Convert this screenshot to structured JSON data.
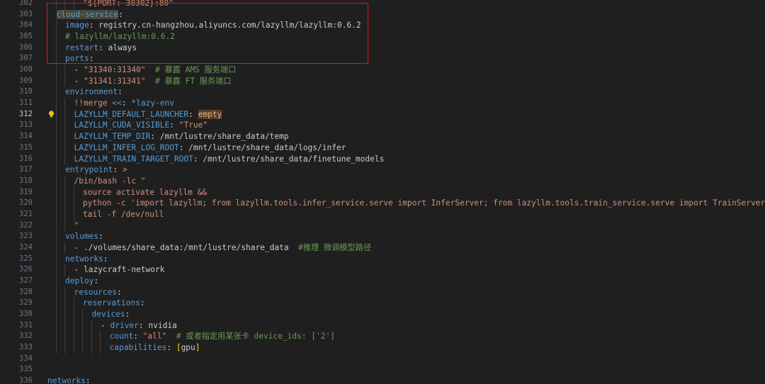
{
  "editor": {
    "active_line": "312",
    "lines": [
      {
        "num": "302",
        "indent": 4,
        "tokens": [
          {
            "t": "\"${PORT: 30302}:80\"",
            "c": "s"
          }
        ]
      },
      {
        "num": "303",
        "indent": 1,
        "tokens": [
          {
            "t": "cloud-service",
            "c": "k selk"
          },
          {
            "t": ":",
            "c": "p"
          }
        ]
      },
      {
        "num": "304",
        "indent": 2,
        "tokens": [
          {
            "t": "image",
            "c": "k"
          },
          {
            "t": ": ",
            "c": "p"
          },
          {
            "t": "registry.cn-hangzhou.aliyuncs.com/lazyllm/lazyllm:0.6.2",
            "c": "r"
          }
        ]
      },
      {
        "num": "305",
        "indent": 2,
        "tokens": [
          {
            "t": "# lazyllm/lazyllm:0.6.2",
            "c": "c"
          }
        ]
      },
      {
        "num": "306",
        "indent": 2,
        "tokens": [
          {
            "t": "restart",
            "c": "k"
          },
          {
            "t": ": ",
            "c": "p"
          },
          {
            "t": "always",
            "c": "r"
          }
        ]
      },
      {
        "num": "307",
        "indent": 2,
        "tokens": [
          {
            "t": "ports",
            "c": "k"
          },
          {
            "t": ":",
            "c": "p"
          }
        ]
      },
      {
        "num": "308",
        "indent": 3,
        "tokens": [
          {
            "t": "- ",
            "c": "p"
          },
          {
            "t": "\"31340:31340\"",
            "c": "s"
          },
          {
            "t": "  # 暴露 AMS 服务端口",
            "c": "c"
          }
        ]
      },
      {
        "num": "309",
        "indent": 3,
        "tokens": [
          {
            "t": "- ",
            "c": "p"
          },
          {
            "t": "\"31341:31341\"",
            "c": "s"
          },
          {
            "t": "  # 暴露 FT 服务端口",
            "c": "c"
          }
        ]
      },
      {
        "num": "310",
        "indent": 2,
        "tokens": [
          {
            "t": "environment",
            "c": "k"
          },
          {
            "t": ":",
            "c": "p"
          }
        ]
      },
      {
        "num": "311",
        "indent": 3,
        "tokens": [
          {
            "t": "!!merge",
            "c": "s"
          },
          {
            "t": " ",
            "c": "p"
          },
          {
            "t": "<<",
            "c": "k"
          },
          {
            "t": ": ",
            "c": "p"
          },
          {
            "t": "*lazy-env",
            "c": "anchor"
          }
        ]
      },
      {
        "num": "312",
        "indent": 3,
        "tokens": [
          {
            "t": "LAZYLLM_DEFAULT_LAUNCHER",
            "c": "k"
          },
          {
            "t": ": ",
            "c": "p"
          },
          {
            "t": "empty",
            "c": "hl"
          }
        ]
      },
      {
        "num": "313",
        "indent": 3,
        "tokens": [
          {
            "t": "LAZYLLM_CUDA_VISIBLE",
            "c": "k"
          },
          {
            "t": ": ",
            "c": "p"
          },
          {
            "t": "\"True\"",
            "c": "s"
          }
        ]
      },
      {
        "num": "314",
        "indent": 3,
        "tokens": [
          {
            "t": "LAZYLLM_TEMP_DIR",
            "c": "k"
          },
          {
            "t": ": ",
            "c": "p"
          },
          {
            "t": "/mnt/lustre/share_data/temp",
            "c": "r"
          }
        ]
      },
      {
        "num": "315",
        "indent": 3,
        "tokens": [
          {
            "t": "LAZYLLM_INFER_LOG_ROOT",
            "c": "k"
          },
          {
            "t": ": ",
            "c": "p"
          },
          {
            "t": "/mnt/lustre/share_data/logs/infer",
            "c": "r"
          }
        ]
      },
      {
        "num": "316",
        "indent": 3,
        "tokens": [
          {
            "t": "LAZYLLM_TRAIN_TARGET_ROOT",
            "c": "k"
          },
          {
            "t": ": ",
            "c": "p"
          },
          {
            "t": "/mnt/lustre/share_data/finetune_models",
            "c": "r"
          }
        ]
      },
      {
        "num": "317",
        "indent": 2,
        "tokens": [
          {
            "t": "entrypoint",
            "c": "k"
          },
          {
            "t": ": ",
            "c": "p"
          },
          {
            "t": ">",
            "c": "s"
          }
        ]
      },
      {
        "num": "318",
        "indent": 3,
        "tokens": [
          {
            "t": "/bin/bash -lc \"",
            "c": "s"
          }
        ]
      },
      {
        "num": "319",
        "indent": 4,
        "tokens": [
          {
            "t": "source activate lazyllm &&",
            "c": "s"
          }
        ]
      },
      {
        "num": "320",
        "indent": 4,
        "tokens": [
          {
            "t": "python -c 'import lazyllm; from lazyllm.tools.infer_service.serve import InferServer; from lazyllm.tools.train_service.serve import TrainServer; infere",
            "c": "s"
          }
        ]
      },
      {
        "num": "321",
        "indent": 4,
        "tokens": [
          {
            "t": "tail -f /dev/null",
            "c": "s"
          }
        ]
      },
      {
        "num": "322",
        "indent": 3,
        "tokens": [
          {
            "t": "\"",
            "c": "s"
          }
        ]
      },
      {
        "num": "323",
        "indent": 2,
        "tokens": [
          {
            "t": "volumes",
            "c": "k"
          },
          {
            "t": ":",
            "c": "p"
          }
        ]
      },
      {
        "num": "324",
        "indent": 3,
        "tokens": [
          {
            "t": "- ",
            "c": "p"
          },
          {
            "t": "./volumes/share_data:/mnt/lustre/share_data",
            "c": "r"
          },
          {
            "t": "  #推理 微调模型路径",
            "c": "c"
          }
        ]
      },
      {
        "num": "325",
        "indent": 2,
        "tokens": [
          {
            "t": "networks",
            "c": "k"
          },
          {
            "t": ":",
            "c": "p"
          }
        ]
      },
      {
        "num": "326",
        "indent": 3,
        "tokens": [
          {
            "t": "- ",
            "c": "p"
          },
          {
            "t": "lazycraft-network",
            "c": "r"
          }
        ]
      },
      {
        "num": "327",
        "indent": 2,
        "tokens": [
          {
            "t": "deploy",
            "c": "k"
          },
          {
            "t": ":",
            "c": "p"
          }
        ]
      },
      {
        "num": "328",
        "indent": 3,
        "tokens": [
          {
            "t": "resources",
            "c": "k"
          },
          {
            "t": ":",
            "c": "p"
          }
        ]
      },
      {
        "num": "329",
        "indent": 4,
        "tokens": [
          {
            "t": "reservations",
            "c": "k"
          },
          {
            "t": ":",
            "c": "p"
          }
        ]
      },
      {
        "num": "330",
        "indent": 5,
        "tokens": [
          {
            "t": "devices",
            "c": "k"
          },
          {
            "t": ":",
            "c": "p"
          }
        ]
      },
      {
        "num": "331",
        "indent": 6,
        "tokens": [
          {
            "t": "- ",
            "c": "p"
          },
          {
            "t": "driver",
            "c": "k"
          },
          {
            "t": ": ",
            "c": "p"
          },
          {
            "t": "nvidia",
            "c": "r"
          }
        ]
      },
      {
        "num": "332",
        "indent": 7,
        "tokens": [
          {
            "t": "count",
            "c": "k"
          },
          {
            "t": ": ",
            "c": "p"
          },
          {
            "t": "\"all\"",
            "c": "s"
          },
          {
            "t": "  # 或者指定用某张卡 device_ids: ['2']",
            "c": "c"
          }
        ]
      },
      {
        "num": "333",
        "indent": 7,
        "tokens": [
          {
            "t": "capabilities",
            "c": "k"
          },
          {
            "t": ": ",
            "c": "p"
          },
          {
            "t": "[",
            "c": "br"
          },
          {
            "t": "gpu",
            "c": "r"
          },
          {
            "t": "]",
            "c": "br"
          }
        ]
      },
      {
        "num": "334",
        "indent": 0,
        "tokens": []
      },
      {
        "num": "335",
        "indent": 0,
        "tokens": []
      },
      {
        "num": "336",
        "indent": 0,
        "tokens": [
          {
            "t": "networks",
            "c": "k"
          },
          {
            "t": ":",
            "c": "p"
          }
        ]
      }
    ]
  },
  "icons": {
    "lightbulb": "lightbulb-icon",
    "fold_marker": "fold-chevron-icon"
  },
  "colors": {
    "background": "#1f1f1f",
    "annotation_box": "#e0161f",
    "yaml_key": "#569cd6",
    "string": "#ce9178",
    "comment": "#6a9955"
  }
}
